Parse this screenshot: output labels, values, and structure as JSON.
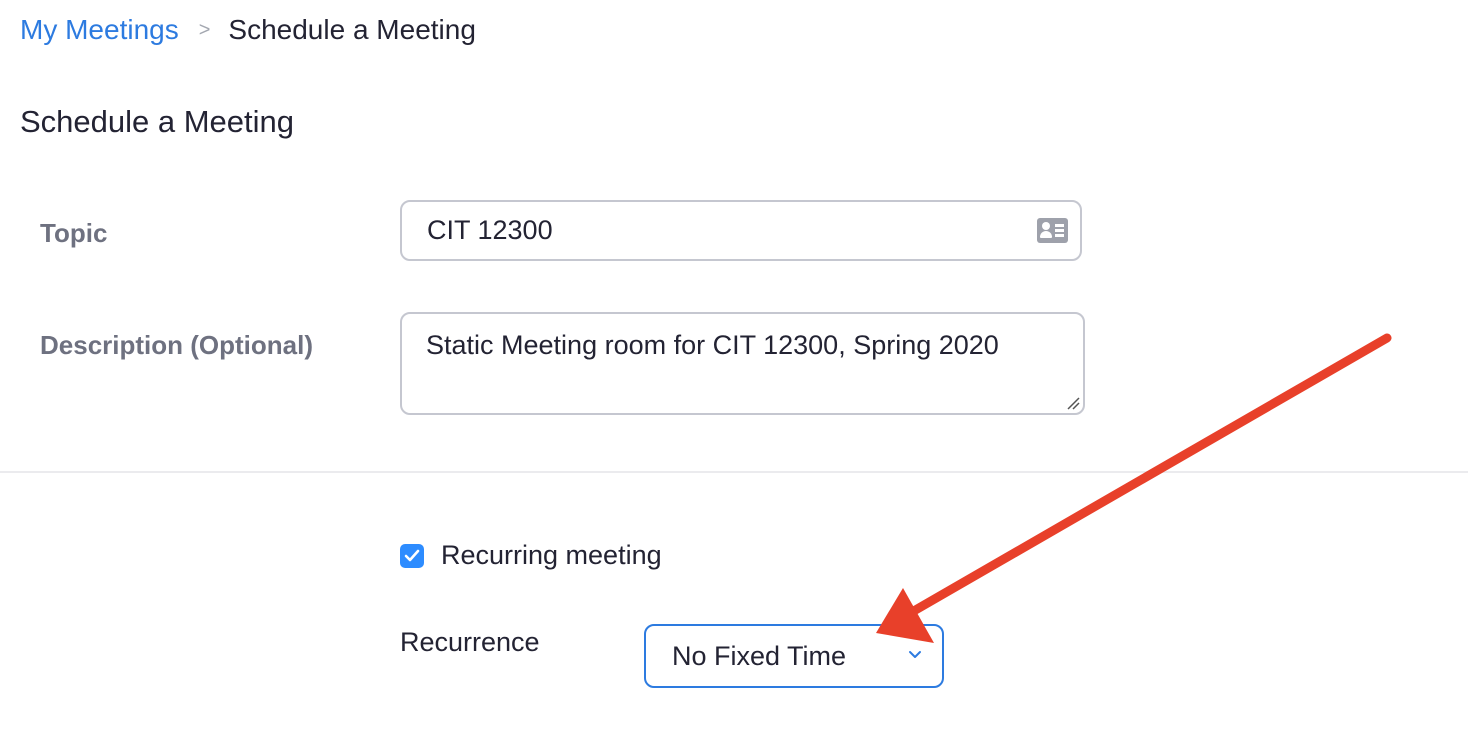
{
  "breadcrumb": {
    "parent": "My Meetings",
    "separator": ">",
    "current": "Schedule a Meeting"
  },
  "page_title": "Schedule a Meeting",
  "form": {
    "topic": {
      "label": "Topic",
      "value": "CIT 12300",
      "icon": "contact-card-icon"
    },
    "description": {
      "label": "Description (Optional)",
      "value": "Static Meeting room for CIT 12300, Spring 2020"
    },
    "recurring": {
      "label": "Recurring meeting",
      "checked": true
    },
    "recurrence": {
      "label": "Recurrence",
      "value": "No Fixed Time",
      "icon": "chevron-down-icon"
    }
  },
  "colors": {
    "link": "#2d7be0",
    "checkbox": "#2d8cff",
    "annotation_arrow": "#e8402a"
  }
}
